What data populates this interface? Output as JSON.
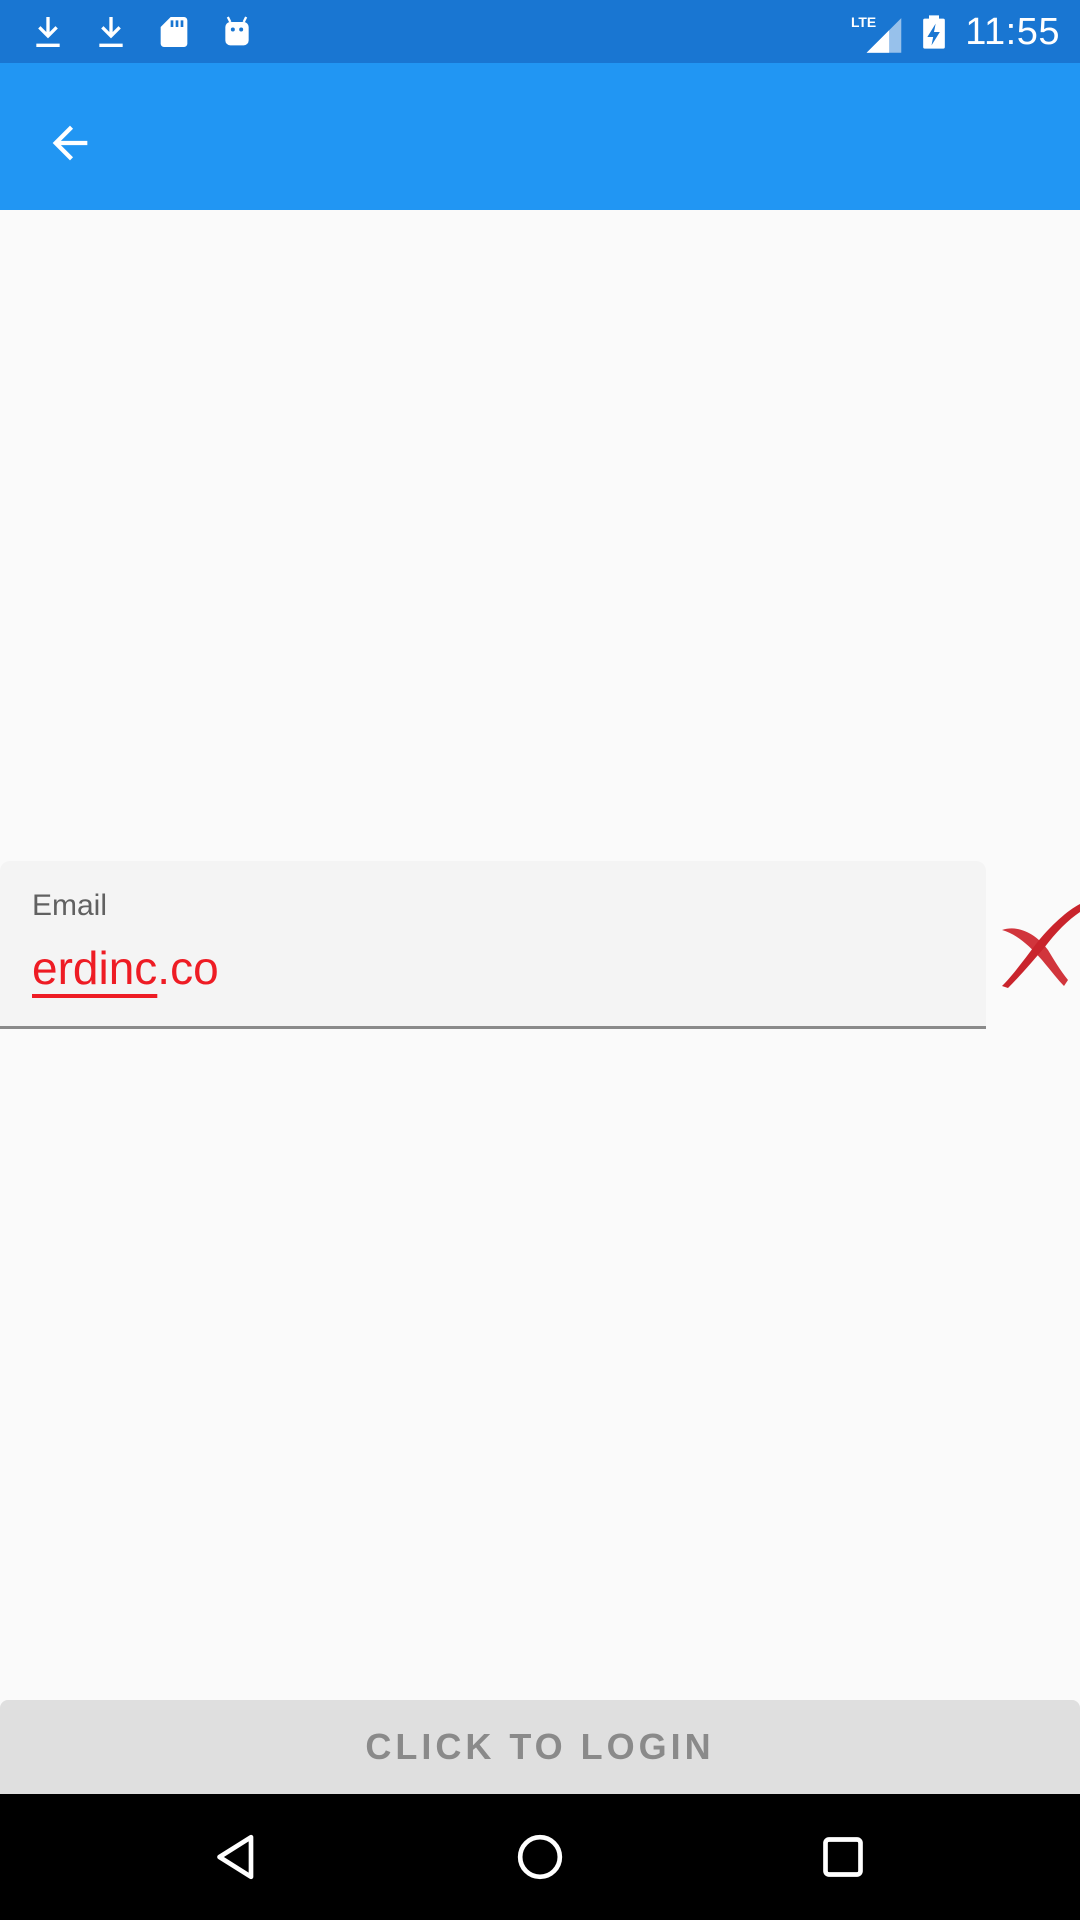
{
  "status_bar": {
    "time": "11:55",
    "network": "LTE",
    "icons": [
      "download-icon",
      "download-icon",
      "sd-card-icon",
      "android-icon",
      "lte-signal-icon",
      "battery-charging-icon"
    ]
  },
  "app_bar": {
    "back_icon": "arrow-back-icon",
    "color": "#2196f3"
  },
  "form": {
    "email_label": "Email",
    "email_value_underlined": "erdinc",
    "email_value_rest": ".co",
    "email_text_color": "#ee1c24",
    "validation_icon": "invalid-x-icon"
  },
  "login_button": {
    "label": "CLICK TO LOGIN"
  },
  "nav_bar": {
    "icons": [
      "back-triangle-icon",
      "home-circle-icon",
      "recents-square-icon"
    ]
  }
}
